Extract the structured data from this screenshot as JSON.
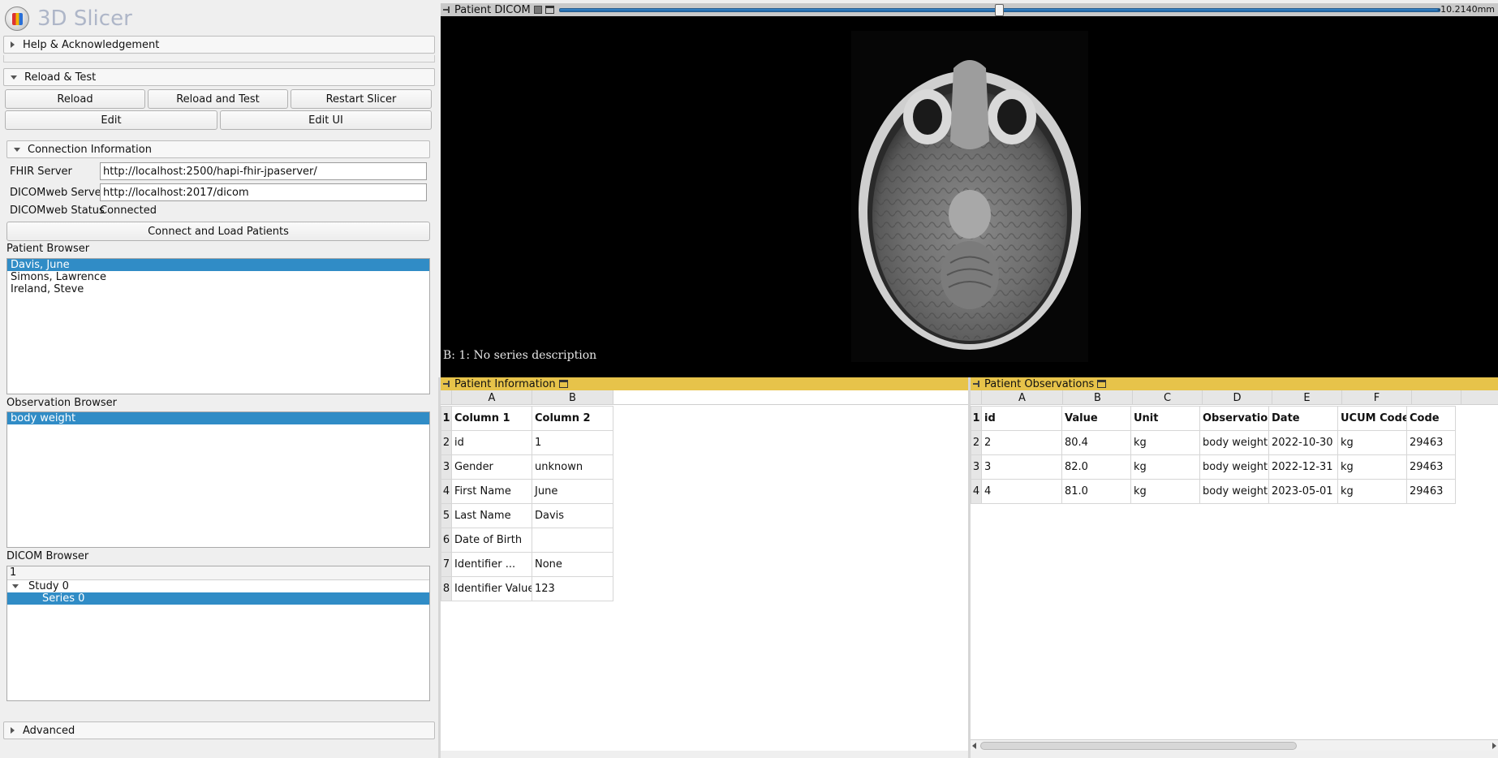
{
  "app": {
    "title": "3D Slicer"
  },
  "sections": {
    "help": "Help & Acknowledgement",
    "reload_test": "Reload & Test",
    "connection": "Connection Information",
    "advanced": "Advanced"
  },
  "buttons": {
    "reload": "Reload",
    "reload_and_test": "Reload and Test",
    "restart": "Restart Slicer",
    "edit": "Edit",
    "edit_ui": "Edit UI",
    "connect": "Connect and Load Patients"
  },
  "connection": {
    "fhir_label": "FHIR Server",
    "fhir_value": "http://localhost:2500/hapi-fhir-jpaserver/",
    "dicomweb_label": "DICOMweb Server",
    "dicomweb_value": "http://localhost:2017/dicom",
    "status_label": "DICOMweb Status",
    "status_value": "Connected"
  },
  "patient_browser": {
    "label": "Patient Browser",
    "items": [
      "Davis, June",
      "Simons, Lawrence",
      "Ireland, Steve"
    ]
  },
  "observation_browser": {
    "label": "Observation Browser",
    "items": [
      "body weight"
    ]
  },
  "dicom_browser": {
    "label": "DICOM Browser",
    "header": "1",
    "study": "Study 0",
    "series": "Series 0"
  },
  "slice_view": {
    "name": "Patient DICOM",
    "offset": "-10.2140mm",
    "offset_fraction": 0.5,
    "caption": "B: 1: No series description"
  },
  "patient_info": {
    "title": "Patient Information",
    "col_letters": [
      "A",
      "B"
    ],
    "rows": [
      [
        "Column 1",
        "Column 2"
      ],
      [
        "id",
        "1"
      ],
      [
        "Gender",
        "unknown"
      ],
      [
        "First Name",
        "June"
      ],
      [
        "Last Name",
        "Davis"
      ],
      [
        "Date of Birth",
        ""
      ],
      [
        "Identifier ...",
        "None"
      ],
      [
        "Identifier Value",
        "123"
      ]
    ]
  },
  "observations": {
    "title": "Patient Observations",
    "col_letters": [
      "A",
      "B",
      "C",
      "D",
      "E",
      "F",
      ""
    ],
    "rows": [
      [
        "id",
        "Value",
        "Unit",
        "Observatio...",
        "Date",
        "UCUM Code",
        "Code"
      ],
      [
        "2",
        "80.4",
        "kg",
        "body weight",
        "2022-10-30 ...",
        "kg",
        "29463"
      ],
      [
        "3",
        "82.0",
        "kg",
        "body weight",
        "2022-12-31 ...",
        "kg",
        "29463"
      ],
      [
        "4",
        "81.0",
        "kg",
        "body weight",
        "2023-05-01 ...",
        "kg",
        "29463"
      ]
    ]
  }
}
